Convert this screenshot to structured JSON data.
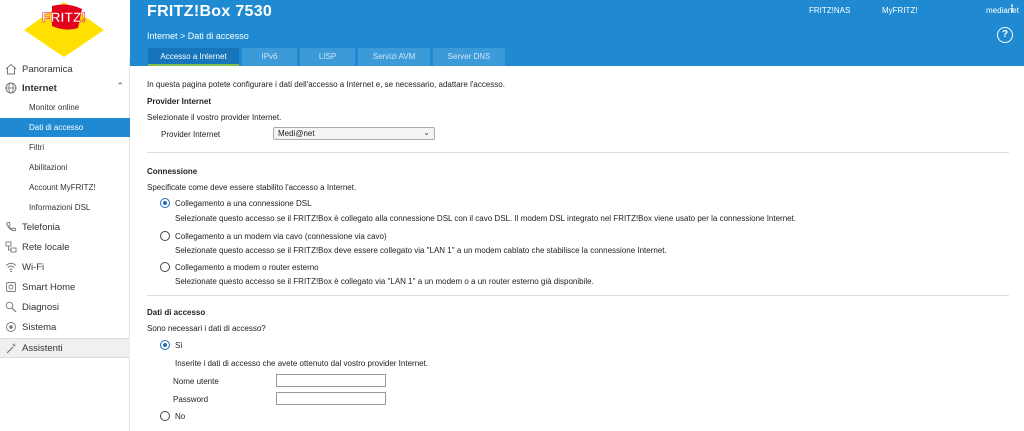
{
  "header": {
    "logo_text": "FRITZ!",
    "product_name": "FRITZ!Box 7530",
    "links": [
      "FRITZ!NAS",
      "MyFRITZ!",
      "medianet"
    ],
    "breadcrumb": "Internet > Dati di accesso"
  },
  "tabs": [
    "Accesso a Internet",
    "IPv6",
    "LISP",
    "Servizi AVM",
    "Server DNS"
  ],
  "active_tab": "Accesso a Internet",
  "sidebar": {
    "items": [
      {
        "label": "Panoramica",
        "icon": "home-icon"
      },
      {
        "label": "Internet",
        "icon": "globe-icon",
        "expanded": true
      },
      {
        "label": "Telefonia",
        "icon": "phone-icon"
      },
      {
        "label": "Rete locale",
        "icon": "network-icon"
      },
      {
        "label": "Wi-Fi",
        "icon": "wifi-icon"
      },
      {
        "label": "Smart Home",
        "icon": "smart-home-icon"
      },
      {
        "label": "Diagnosi",
        "icon": "diagnosis-icon"
      },
      {
        "label": "Sistema",
        "icon": "system-icon"
      },
      {
        "label": "Assistenti",
        "icon": "wizard-icon"
      }
    ],
    "subitems": [
      "Monitor online",
      "Dati di accesso",
      "Filtri",
      "Abilitazioni",
      "Account MyFRITZ!",
      "Informazioni DSL"
    ],
    "active_subitem": "Dati di accesso"
  },
  "main": {
    "intro": "In questa pagina potete configurare i dati dell'accesso a Internet e, se necessario, adattare l'accesso.",
    "provider": {
      "heading": "Provider Internet",
      "description": "Selezionate il vostro provider Internet.",
      "label": "Provider Internet",
      "selected": "Medi@net"
    },
    "connection": {
      "heading": "Connessione",
      "description": "Specificate come deve essere stabilito l'accesso a Internet.",
      "options": [
        {
          "label": "Collegamento a una connessione DSL",
          "detail": "Selezionate questo accesso se il FRITZ!Box è collegato alla connessione DSL con il cavo DSL. Il modem DSL integrato nel FRITZ!Box viene usato per la connessione Internet.",
          "selected": true
        },
        {
          "label": "Collegamento a un modem via cavo (connessione via cavo)",
          "detail": "Selezionate questo accesso se il FRITZ!Box deve essere collegato via \"LAN 1\" a un modem cablato che stabilisce la connessione Internet.",
          "selected": false
        },
        {
          "label": "Collegamento a modem o router esterno",
          "detail": "Selezionate questo accesso se il FRITZ!Box è collegato via \"LAN 1\" a un modem o a un router esterno già disponibile.",
          "selected": false
        }
      ]
    },
    "access": {
      "heading": "Dati di accesso",
      "question": "Sono necessari i dati di accesso?",
      "yes_label": "Sì",
      "yes_detail": "Inserite i dati di accesso che avete ottenuto dal vostro provider Internet.",
      "username_label": "Nome utente",
      "username_value": "",
      "password_label": "Password",
      "password_value": "",
      "no_label": "No",
      "selected": "yes"
    }
  },
  "colors": {
    "brand_blue": "#1f8ad1",
    "active_tab": "#1776bb",
    "tab_underline": "#7ec04b",
    "logo_red": "#e2001a",
    "logo_yellow": "#ffe000"
  }
}
